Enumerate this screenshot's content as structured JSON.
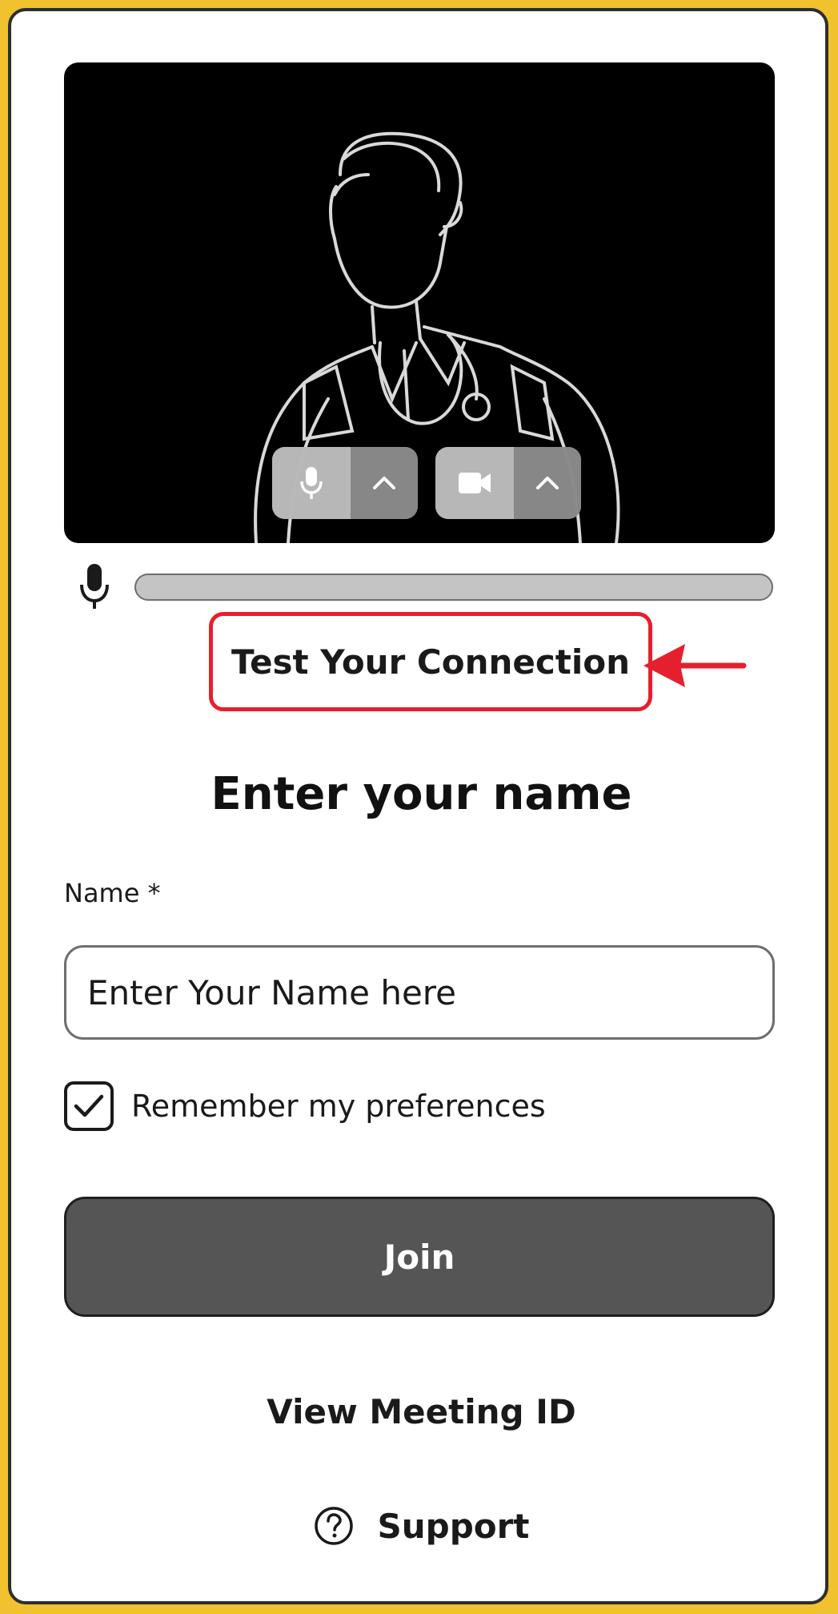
{
  "preview": {
    "mic_button_icon": "microphone-icon",
    "mic_options_icon": "chevron-up-icon",
    "camera_button_icon": "video-camera-icon",
    "camera_options_icon": "chevron-up-icon"
  },
  "mic_level": {
    "icon": "microphone-icon",
    "level": 0
  },
  "test_connection": {
    "label": "Test Your Connection"
  },
  "form": {
    "heading": "Enter your name",
    "name_label": "Name *",
    "name_placeholder": "Enter Your Name here",
    "remember_label": "Remember my preferences",
    "remember_checked": true
  },
  "actions": {
    "join_label": "Join",
    "view_meeting_id_label": "View Meeting ID",
    "support_label": "Support",
    "support_icon": "question-circle-icon"
  },
  "colors": {
    "page_border": "#f2c12e",
    "annotation": "#e5202e",
    "join_button": "#555555"
  }
}
